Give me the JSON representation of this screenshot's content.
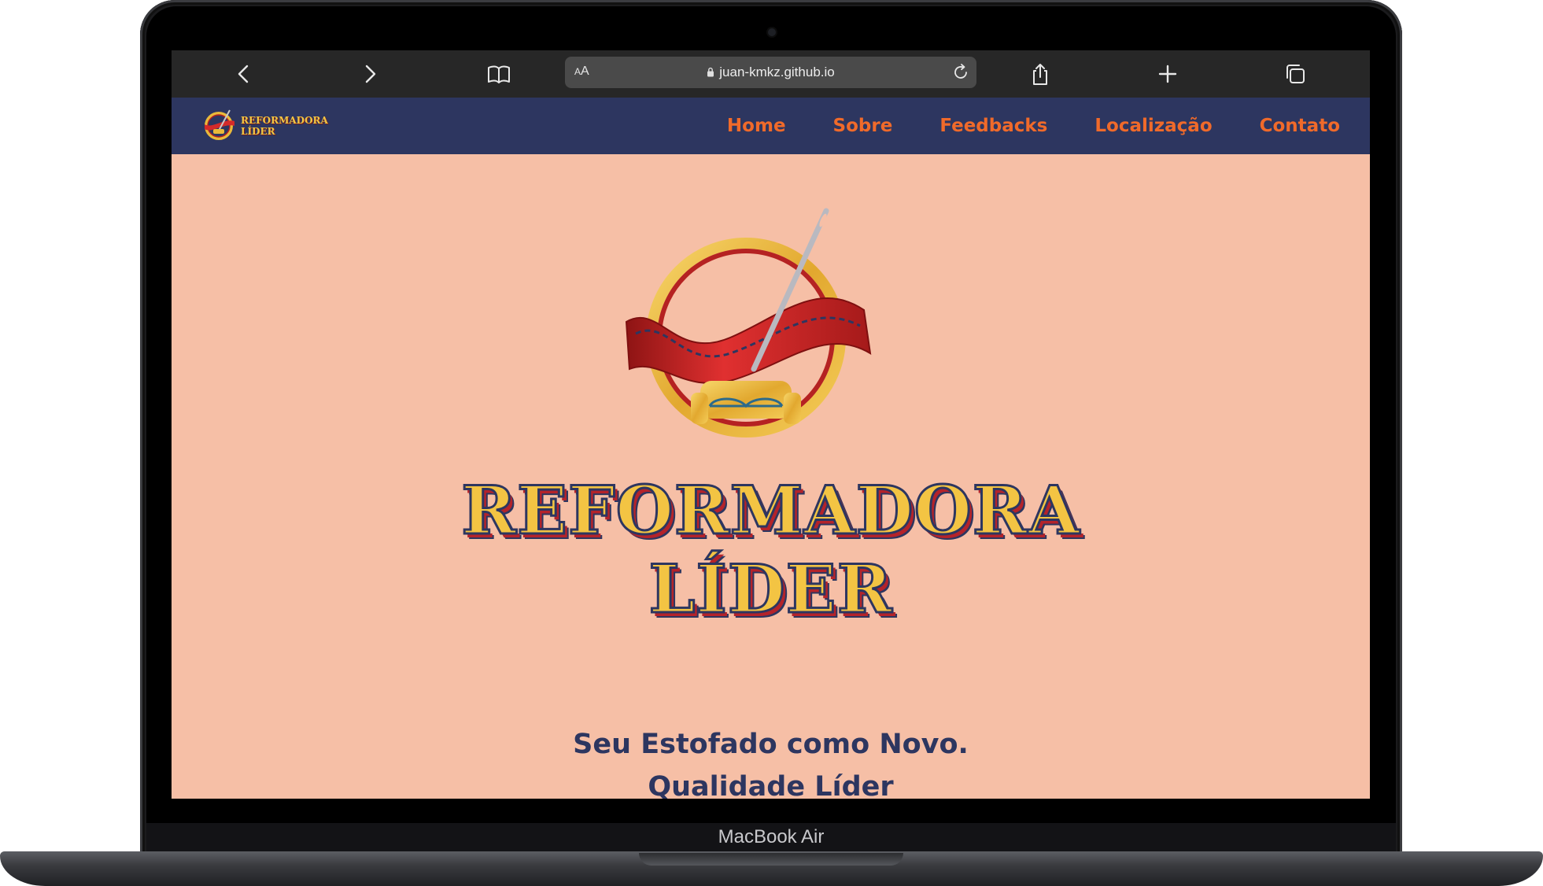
{
  "device": {
    "model_label": "MacBook Air"
  },
  "browser": {
    "text_size_label": "AA",
    "url": "juan-kmkz.github.io",
    "buttons": [
      "back-icon",
      "forward-icon",
      "bookmarks-icon",
      "reload-icon",
      "share-icon",
      "new-tab-icon",
      "tabs-icon"
    ]
  },
  "site": {
    "logo_text": [
      "REFORMADORA",
      "LÍDER"
    ],
    "nav": [
      "Home",
      "Sobre",
      "Feedbacks",
      "Localização",
      "Contato"
    ],
    "hero": {
      "title_line1": "REFORMADORA",
      "title_line2": "LÍDER",
      "tagline_line1": "Seu Estofado como Novo.",
      "tagline_line2": "Qualidade Líder"
    },
    "colors": {
      "page_bg": "#f6bfa6",
      "nav_bg": "#2d3660",
      "nav_link": "#f06a2a",
      "gold": "#f3c443",
      "ribbon_red": "#d42a2a",
      "navy_text": "#2d3660"
    }
  }
}
